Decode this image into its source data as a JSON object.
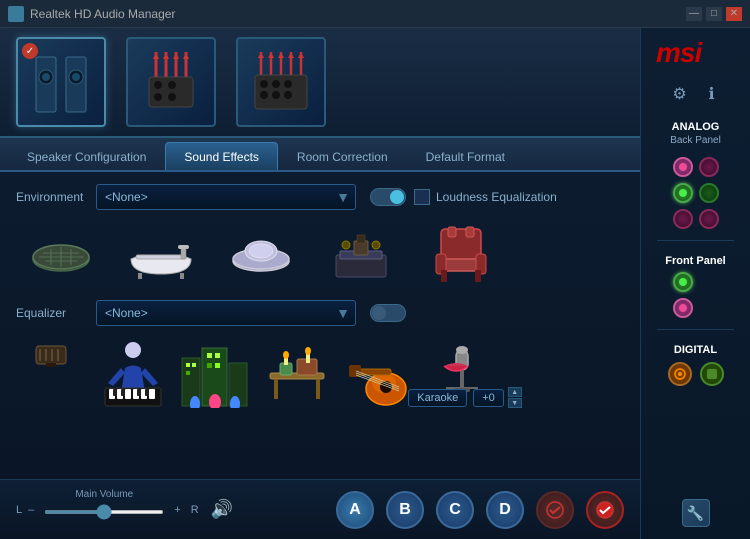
{
  "window": {
    "title": "Realtek HD Audio Manager",
    "minimize": "—",
    "maximize": "□",
    "close": "✕"
  },
  "tabs": [
    {
      "id": "speaker-config",
      "label": "Speaker Configuration",
      "active": false
    },
    {
      "id": "sound-effects",
      "label": "Sound Effects",
      "active": true
    },
    {
      "id": "room-correction",
      "label": "Room Correction",
      "active": false
    },
    {
      "id": "default-format",
      "label": "Default Format",
      "active": false
    }
  ],
  "sound_effects": {
    "environment_label": "Environment",
    "environment_value": "<None>",
    "loudness_label": "Loudness Equalization",
    "equalizer_label": "Equalizer",
    "equalizer_value": "<None>"
  },
  "bottom": {
    "volume_label": "Main Volume",
    "l_label": "L",
    "r_label": "R",
    "minus": "–",
    "plus": "+",
    "buttons": [
      "A",
      "B",
      "C",
      "D"
    ]
  },
  "right_panel": {
    "logo": "msi",
    "analog_label": "ANALOG",
    "back_panel_label": "Back Panel",
    "front_panel_label": "Front Panel",
    "digital_label": "DIGITAL"
  },
  "karaoke": {
    "label": "Karaoke",
    "value": "+0"
  },
  "icons": {
    "gear": "⚙",
    "info": "ℹ",
    "wrench": "🔧",
    "sound": "🔊",
    "check": "✓",
    "x": "✕",
    "up": "▲",
    "down": "▼"
  }
}
